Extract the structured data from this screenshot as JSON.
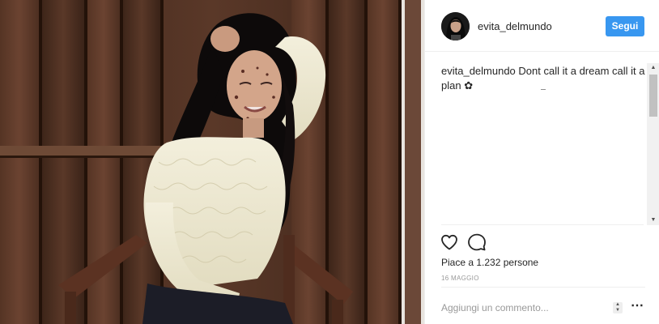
{
  "post": {
    "photo_icon": "photo"
  },
  "header": {
    "username": "evita_delmundo",
    "follow_label": "Segui"
  },
  "caption": {
    "username": "evita_delmundo",
    "text": "Dont call it a dream call it a plan ✿"
  },
  "actions": {
    "like_icon": "heart-icon",
    "comment_icon": "comment-icon"
  },
  "likes": {
    "text": "Piace a 1.232 persone"
  },
  "date": {
    "text": "16 MAGGIO"
  },
  "comment_box": {
    "placeholder": "Aggiungi un commento...",
    "more_label": "•••"
  },
  "colors": {
    "follow_button": "#3897f0",
    "text": "#262626",
    "muted": "#999999",
    "divider": "#efefef"
  }
}
